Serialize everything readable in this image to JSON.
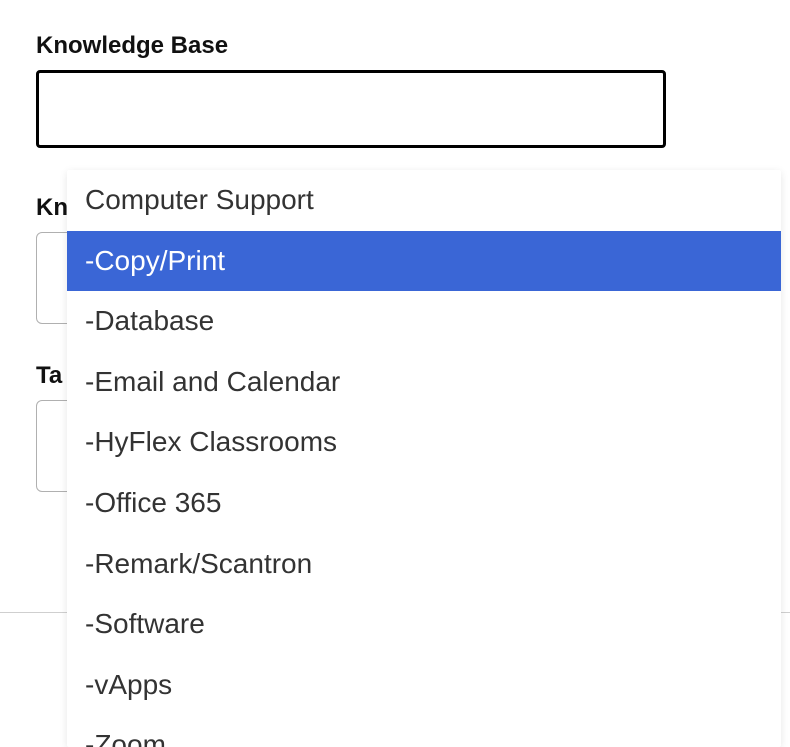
{
  "fields": {
    "knowledgeBase": {
      "label": "Knowledge Base",
      "value": ""
    },
    "second": {
      "labelVisible": "Kn",
      "value": ""
    },
    "third": {
      "labelVisible": "Ta",
      "value": ""
    }
  },
  "dropdown": {
    "items": [
      {
        "label": "Computer Support",
        "selected": false
      },
      {
        "label": "-Copy/Print",
        "selected": true
      },
      {
        "label": "-Database",
        "selected": false
      },
      {
        "label": "-Email and Calendar",
        "selected": false
      },
      {
        "label": "-HyFlex Classrooms",
        "selected": false
      },
      {
        "label": "-Office 365",
        "selected": false
      },
      {
        "label": "-Remark/Scantron",
        "selected": false
      },
      {
        "label": "-Software",
        "selected": false
      },
      {
        "label": "-vApps",
        "selected": false
      },
      {
        "label": "-Zoom",
        "selected": false
      }
    ]
  },
  "colors": {
    "highlight": "#3a66d6"
  }
}
